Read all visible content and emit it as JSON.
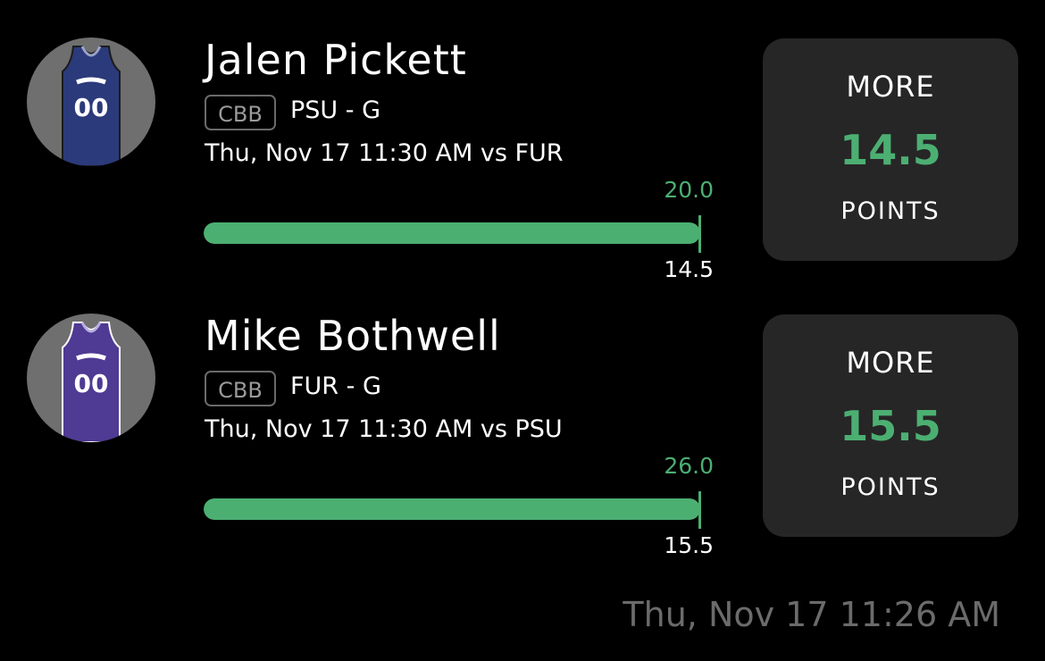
{
  "colors": {
    "background": "#000000",
    "accent_green": "#4caf72",
    "card": "#262626",
    "muted_text": "#6b6b6b"
  },
  "picks": [
    {
      "player_name": "Jalen Pickett",
      "league": "CBB",
      "team_position": "PSU - G",
      "game_info": "Thu, Nov 17 11:30 AM  vs FUR",
      "jersey_number": "00",
      "jersey_color": "#2b3a7a",
      "bar_top_value": "20.0",
      "bar_bottom_value": "14.5",
      "progress_fraction": 1.0,
      "projection": {
        "direction": "MORE",
        "line": "14.5",
        "stat": "POINTS"
      }
    },
    {
      "player_name": "Mike Bothwell",
      "league": "CBB",
      "team_position": "FUR - G",
      "game_info": "Thu, Nov 17 11:30 AM  vs PSU",
      "jersey_number": "00",
      "jersey_color": "#4f3a94",
      "bar_top_value": "26.0",
      "bar_bottom_value": "15.5",
      "progress_fraction": 1.0,
      "projection": {
        "direction": "MORE",
        "line": "15.5",
        "stat": "POINTS"
      }
    }
  ],
  "timestamp": "Thu, Nov 17 11:26 AM"
}
